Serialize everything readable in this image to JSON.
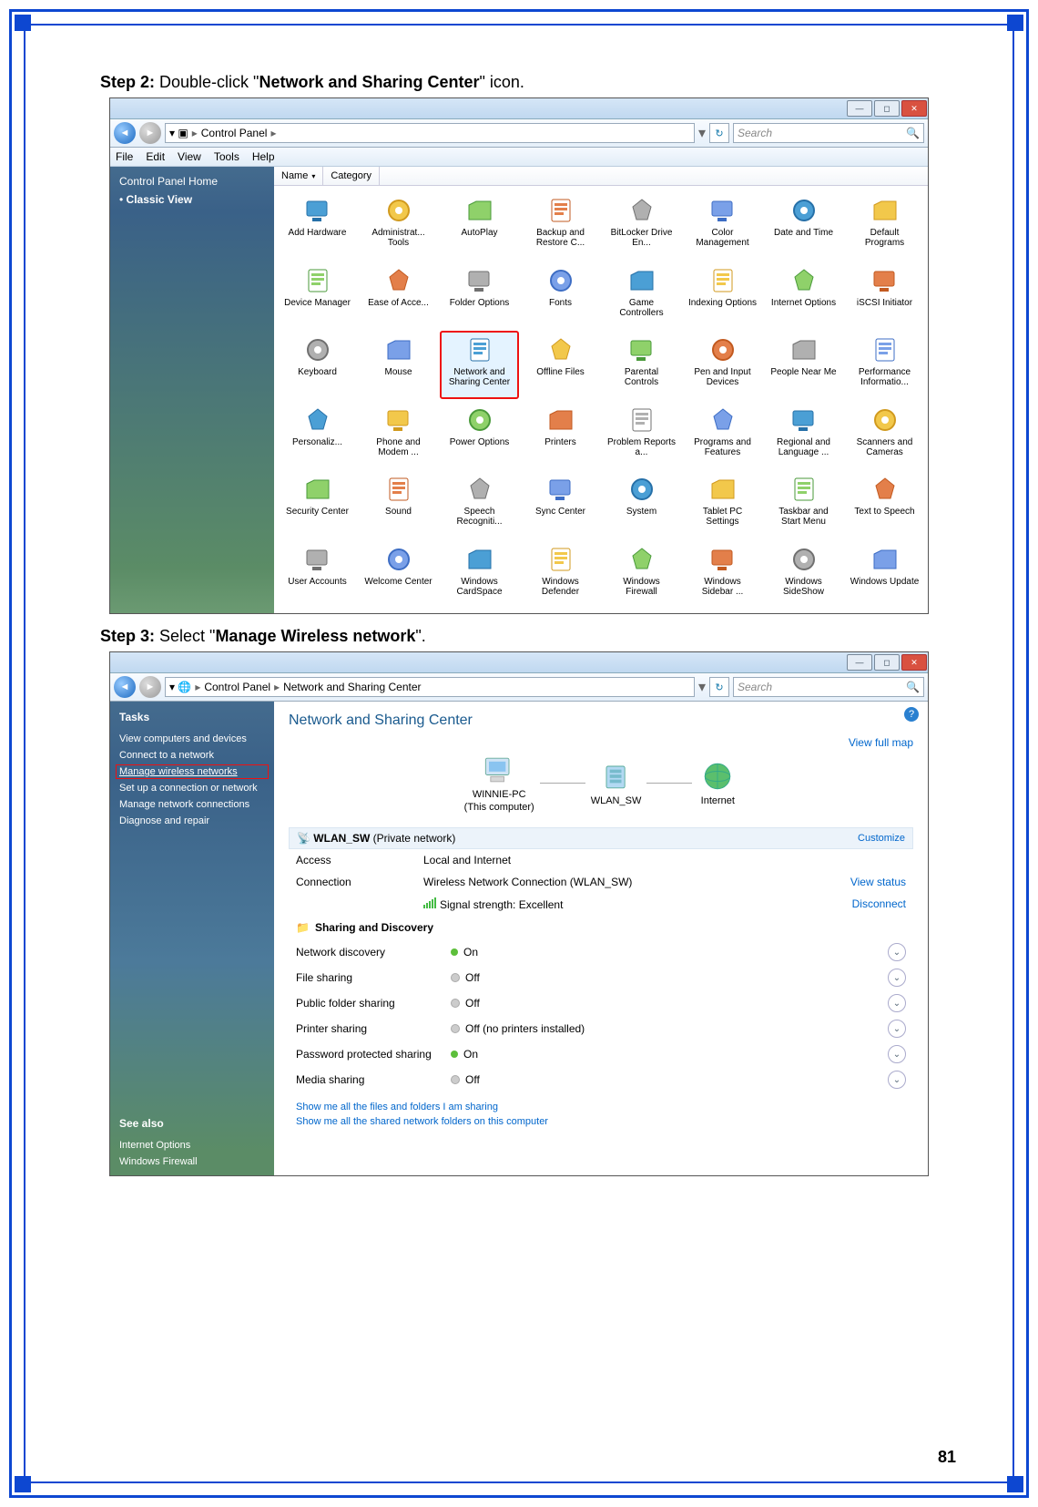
{
  "page_number": "81",
  "step2": {
    "label": "Step 2:",
    "text_a": " Double-click \"",
    "bold": "Network and Sharing Center",
    "text_b": "\" icon."
  },
  "step3": {
    "label": "Step 3:",
    "text_a": " Select \"",
    "bold": "Manage Wireless network",
    "text_b": "\"."
  },
  "win_common": {
    "search_placeholder": "Search",
    "menu": [
      "File",
      "Edit",
      "View",
      "Tools",
      "Help"
    ]
  },
  "win1": {
    "breadcrumb": [
      "Control Panel"
    ],
    "sidebar_title": "Control Panel Home",
    "sidebar_item": "Classic View",
    "headers": [
      "Name",
      "Category"
    ],
    "highlighted": "Network and Sharing Center",
    "icons": [
      "Add Hardware",
      "Administrat... Tools",
      "AutoPlay",
      "Backup and Restore C...",
      "BitLocker Drive En...",
      "Color Management",
      "Date and Time",
      "Default Programs",
      "Device Manager",
      "Ease of Acce...",
      "Folder Options",
      "Fonts",
      "Game Controllers",
      "Indexing Options",
      "Internet Options",
      "iSCSI Initiator",
      "Keyboard",
      "Mouse",
      "Network and Sharing Center",
      "Offline Files",
      "Parental Controls",
      "Pen and Input Devices",
      "People Near Me",
      "Performance Informatio...",
      "Personaliz...",
      "Phone and Modem ...",
      "Power Options",
      "Printers",
      "Problem Reports a...",
      "Programs and Features",
      "Regional and Language ...",
      "Scanners and Cameras",
      "Security Center",
      "Sound",
      "Speech Recogniti...",
      "Sync Center",
      "System",
      "Tablet PC Settings",
      "Taskbar and Start Menu",
      "Text to Speech",
      "User Accounts",
      "Welcome Center",
      "Windows CardSpace",
      "Windows Defender",
      "Windows Firewall",
      "Windows Sidebar ...",
      "Windows SideShow",
      "Windows Update"
    ]
  },
  "win2": {
    "breadcrumb": [
      "Control Panel",
      "Network and Sharing Center"
    ],
    "tasks_heading": "Tasks",
    "tasks": [
      "View computers and devices",
      "Connect to a network",
      "Manage wireless networks",
      "Set up a connection or network",
      "Manage network connections",
      "Diagnose and repair"
    ],
    "highlighted_task": "Manage wireless networks",
    "seealso_heading": "See also",
    "seealso": [
      "Internet Options",
      "Windows Firewall"
    ],
    "title": "Network and Sharing Center",
    "viewmap": "View full map",
    "nodes": {
      "pc": "WINNIE-PC",
      "pc_sub": "(This computer)",
      "dev": "WLAN_SW",
      "net": "Internet"
    },
    "network_section": {
      "name": "WLAN_SW",
      "type": "(Private network)",
      "customize": "Customize"
    },
    "access": {
      "k": "Access",
      "v": "Local and Internet"
    },
    "connection": {
      "k": "Connection",
      "v": "Wireless Network Connection (WLAN_SW)",
      "view": "View status",
      "sig": "Signal strength:  Excellent",
      "disc": "Disconnect"
    },
    "sd_heading": "Sharing and Discovery",
    "sd": [
      {
        "k": "Network discovery",
        "v": "On",
        "on": true
      },
      {
        "k": "File sharing",
        "v": "Off",
        "on": false
      },
      {
        "k": "Public folder sharing",
        "v": "Off",
        "on": false
      },
      {
        "k": "Printer sharing",
        "v": "Off (no printers installed)",
        "on": false
      },
      {
        "k": "Password protected sharing",
        "v": "On",
        "on": true
      },
      {
        "k": "Media sharing",
        "v": "Off",
        "on": false
      }
    ],
    "links": [
      "Show me all the files and folders I am sharing",
      "Show me all the shared network folders on this computer"
    ]
  }
}
